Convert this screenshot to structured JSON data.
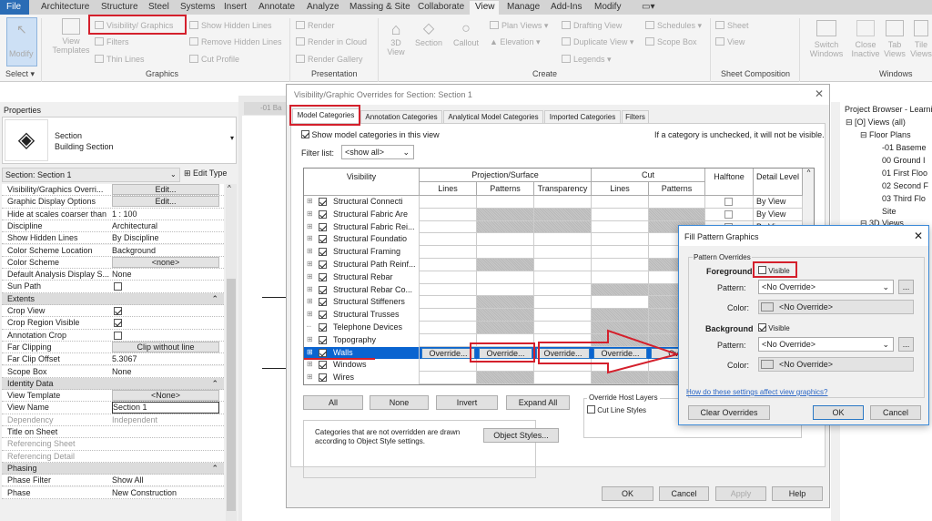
{
  "ribbon_tabs": [
    "File",
    "Architecture",
    "Structure",
    "Steel",
    "Systems",
    "Insert",
    "Annotate",
    "Analyze",
    "Massing & Site",
    "Collaborate",
    "View",
    "Manage",
    "Add-Ins",
    "Modify"
  ],
  "active_tab": "View",
  "ribbon": {
    "modify": "Modify",
    "select": "Select ▾",
    "view_templates": "View Templates",
    "visibility_graphics": "Visibility/ Graphics",
    "filters": "Filters",
    "thin_lines": "Thin Lines",
    "show_hidden_lines": "Show Hidden Lines",
    "remove_hidden_lines": "Remove Hidden Lines",
    "cut_profile": "Cut Profile",
    "render": "Render",
    "render_in_cloud": "Render in Cloud",
    "render_gallery": "Render Gallery",
    "3d_view": "3D View",
    "section": "Section",
    "callout": "Callout",
    "plan_views": "Plan Views ▾",
    "elevation": "Elevation ▾",
    "drafting_view": "Drafting View",
    "duplicate_view": "Duplicate View ▾",
    "legends": "Legends ▾",
    "schedules": "Schedules ▾",
    "scope_box": "Scope Box",
    "sheet": "Sheet",
    "view": "View",
    "switch_windows": "Switch Windows",
    "close_inactive": "Close Inactive",
    "tab_views": "Tab Views",
    "tile_views": "Tile Views",
    "panels": {
      "graphics": "Graphics",
      "presentation": "Presentation",
      "create": "Create",
      "sheet_composition": "Sheet Composition",
      "windows": "Windows"
    }
  },
  "properties": {
    "title": "Properties",
    "type_name": "Section",
    "type_sub": "Building Section",
    "instance_selector": "Section: Section 1",
    "edit_type": "Edit Type",
    "rows": [
      {
        "name": "Visibility/Graphics Overri...",
        "value": "Edit...",
        "kind": "button"
      },
      {
        "name": "Graphic Display Options",
        "value": "Edit...",
        "kind": "button"
      },
      {
        "name": "Hide at scales coarser than",
        "value": "1 : 100"
      },
      {
        "name": "Discipline",
        "value": "Architectural"
      },
      {
        "name": "Show Hidden Lines",
        "value": "By Discipline"
      },
      {
        "name": "Color Scheme Location",
        "value": "Background"
      },
      {
        "name": "Color Scheme",
        "value": "<none>",
        "kind": "button"
      },
      {
        "name": "Default Analysis Display S...",
        "value": "None"
      },
      {
        "name": "Sun Path",
        "checked": false,
        "kind": "check"
      },
      {
        "name": "Extents",
        "kind": "group"
      },
      {
        "name": "Crop View",
        "checked": true,
        "kind": "check"
      },
      {
        "name": "Crop Region Visible",
        "checked": true,
        "kind": "check"
      },
      {
        "name": "Annotation Crop",
        "checked": false,
        "kind": "check"
      },
      {
        "name": "Far Clipping",
        "value": "Clip without line",
        "kind": "button"
      },
      {
        "name": "Far Clip Offset",
        "value": "5.3067"
      },
      {
        "name": "Scope Box",
        "value": "None"
      },
      {
        "name": "Identity Data",
        "kind": "group"
      },
      {
        "name": "View Template",
        "value": "<None>",
        "kind": "button"
      },
      {
        "name": "View Name",
        "value": "Section 1",
        "kind": "input"
      },
      {
        "name": "Dependency",
        "value": "Independent",
        "kind": "disabled"
      },
      {
        "name": "Title on Sheet",
        "value": ""
      },
      {
        "name": "Referencing Sheet",
        "value": "",
        "kind": "disabled"
      },
      {
        "name": "Referencing Detail",
        "value": "",
        "kind": "disabled"
      },
      {
        "name": "Phasing",
        "kind": "group"
      },
      {
        "name": "Phase Filter",
        "value": "Show All"
      },
      {
        "name": "Phase",
        "value": "New Construction"
      }
    ]
  },
  "view_tab": "-01 Ba",
  "vg_dialog": {
    "title": "Visibility/Graphic Overrides for Section: Section 1",
    "tabs": [
      "Model Categories",
      "Annotation Categories",
      "Analytical Model Categories",
      "Imported Categories",
      "Filters"
    ],
    "active_tab": "Model Categories",
    "show_model_categories": "Show model categories in this view",
    "show_model_categories_checked": true,
    "hint": "If a category is unchecked, it will not be visible.",
    "filter_label": "Filter list:",
    "filter_value": "<show all>",
    "headers": {
      "visibility": "Visibility",
      "projection": "Projection/Surface",
      "cut": "Cut",
      "lines": "Lines",
      "patterns": "Patterns",
      "transparency": "Transparency",
      "cut_lines": "Lines",
      "cut_patterns": "Patterns",
      "halftone": "Halftone",
      "detail_level": "Detail Level"
    },
    "rows": [
      {
        "name": "Structural Connecti",
        "shaded": [],
        "detail": "By View"
      },
      {
        "name": "Structural Fabric Are",
        "shaded": [
          "p",
          "t",
          "cp"
        ],
        "detail": "By View"
      },
      {
        "name": "Structural Fabric Rei...",
        "shaded": [
          "p",
          "t",
          "cp"
        ],
        "detail": "By View"
      },
      {
        "name": "Structural Foundatio",
        "shaded": []
      },
      {
        "name": "Structural Framing",
        "shaded": []
      },
      {
        "name": "Structural Path Reinf...",
        "shaded": [
          "p",
          "cp"
        ]
      },
      {
        "name": "Structural Rebar",
        "shaded": []
      },
      {
        "name": "Structural Rebar Co...",
        "shaded": [
          "cl",
          "cp"
        ]
      },
      {
        "name": "Structural Stiffeners",
        "shaded": [
          "p",
          "cp"
        ]
      },
      {
        "name": "Structural Trusses",
        "shaded": [
          "p",
          "cl",
          "cp"
        ]
      },
      {
        "name": "Telephone Devices",
        "shaded": [
          "p",
          "cl",
          "cp"
        ],
        "leaf": true
      },
      {
        "name": "Topography",
        "shaded": [
          "cl",
          "cp"
        ]
      },
      {
        "name": "Walls",
        "selected": true,
        "override": "Override...",
        "override_short": "Over"
      },
      {
        "name": "Windows",
        "shaded": []
      },
      {
        "name": "Wires",
        "shaded": [
          "p",
          "cl",
          "cp"
        ]
      }
    ],
    "buttons": {
      "all": "All",
      "none": "None",
      "invert": "Invert",
      "expand_all": "Expand All",
      "object_styles": "Object Styles...",
      "ok": "OK",
      "cancel": "Cancel",
      "apply": "Apply",
      "help": "Help"
    },
    "host_layers_title": "Override Host Layers",
    "cut_line_styles": "Cut Line Styles",
    "info": "Categories that are not overridden are drawn according to Object Style settings."
  },
  "fill_dialog": {
    "title": "Fill Pattern Graphics",
    "group": "Pattern Overrides",
    "foreground": "Foreground",
    "foreground_visible": false,
    "background": "Background",
    "background_visible": true,
    "visible": "Visible",
    "pattern_label": "Pattern:",
    "color_label": "Color:",
    "no_override": "<No Override>",
    "browse": "...",
    "help_link": "How do these settings affect view graphics?",
    "clear": "Clear Overrides",
    "ok": "OK",
    "cancel": "Cancel"
  },
  "project_browser": {
    "title": "Project Browser - Learni",
    "root": "Views (all)",
    "floor_plans": "Floor Plans",
    "plans": [
      "-01 Baseme",
      "00 Ground I",
      "01 First Floo",
      "02 Second F",
      "03 Third Flo",
      "Site"
    ],
    "views_3d": "3D Views"
  },
  "colors": {
    "accent": "#2b78c5",
    "highlight_red": "#d4202c",
    "file_tab": "#2a6cb5",
    "selection": "#0a64d0"
  }
}
